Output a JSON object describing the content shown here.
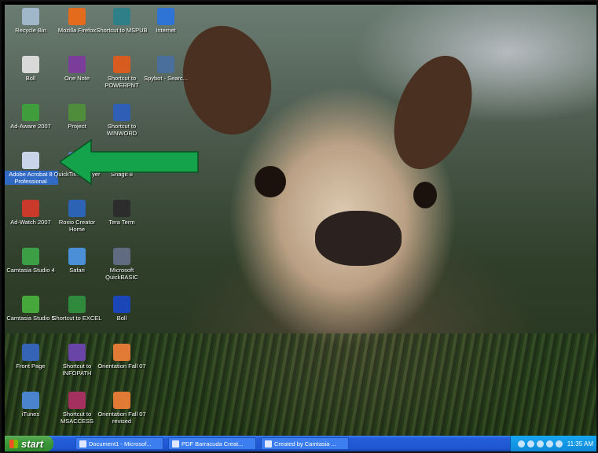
{
  "desktop": {
    "icons": [
      {
        "label": "Recycle Bin",
        "icon": "recycle-bin-icon",
        "color": "#9fb7c9"
      },
      {
        "label": "Mozilla Firefox",
        "icon": "firefox-icon",
        "color": "#e46b1b"
      },
      {
        "label": "Shortcut to MSPUB",
        "icon": "publisher-icon",
        "color": "#2f7f89"
      },
      {
        "label": "Internet",
        "icon": "internet-explorer-icon",
        "color": "#2e74d6"
      },
      {
        "label": "Boll",
        "icon": "document-icon",
        "color": "#d9d9d9"
      },
      {
        "label": "One Note",
        "icon": "onenote-icon",
        "color": "#7a3d9a"
      },
      {
        "label": "Shortcut to POWERPNT",
        "icon": "powerpoint-icon",
        "color": "#d85b20"
      },
      {
        "label": "Spybot - Searc...",
        "icon": "spybot-icon",
        "color": "#4b6f9c"
      },
      {
        "label": "Ad-Aware 2007",
        "icon": "ad-aware-icon",
        "color": "#3f9d3c"
      },
      {
        "label": "Project",
        "icon": "project-icon",
        "color": "#4f8d3d"
      },
      {
        "label": "Shortcut to WINWORD",
        "icon": "word-icon",
        "color": "#2f5fb6"
      },
      {
        "label": "Adobe Acrobat 8 Professional",
        "icon": "adobe-acrobat-icon",
        "color": "#c9d4ea"
      },
      {
        "label": "QuickTime Player",
        "icon": "quicktime-icon",
        "color": "#5a7fc4"
      },
      {
        "label": "SnagIt 8",
        "icon": "snagit-icon",
        "color": "#3d7ec0"
      },
      {
        "label": "Ad-Watch 2007",
        "icon": "ad-watch-icon",
        "color": "#c93a2b"
      },
      {
        "label": "Roxio Creator Home",
        "icon": "roxio-icon",
        "color": "#2d63b5"
      },
      {
        "label": "Tera Term",
        "icon": "teraterm-icon",
        "color": "#2c2c2c"
      },
      {
        "label": "Camtasia Studio 4",
        "icon": "camtasia-icon",
        "color": "#3c9f46"
      },
      {
        "label": "Safari",
        "icon": "safari-icon",
        "color": "#4a8fd8"
      },
      {
        "label": "Microsoft QuickBASIC",
        "icon": "quickbasic-icon",
        "color": "#606a80"
      },
      {
        "label": "Camtasia Studio 5",
        "icon": "camtasia-5-icon",
        "color": "#46a83a"
      },
      {
        "label": "Shortcut to EXCEL",
        "icon": "excel-icon",
        "color": "#2f8a3e"
      },
      {
        "label": "Boll",
        "icon": "s-icon",
        "color": "#1b46b8"
      },
      {
        "label": "Front Page",
        "icon": "frontpage-icon",
        "color": "#3563b5"
      },
      {
        "label": "Shortcut to INFOPATH",
        "icon": "infopath-icon",
        "color": "#6a45a8"
      },
      {
        "label": "Orientation Fall 07",
        "icon": "powerpoint-file-icon",
        "color": "#e07a34"
      },
      {
        "label": "iTunes",
        "icon": "itunes-icon",
        "color": "#4a84cf"
      },
      {
        "label": "Shortcut to MSACCESS",
        "icon": "access-icon",
        "color": "#a3305f"
      },
      {
        "label": "Orientation Fall 07 revised",
        "icon": "powerpoint-file-icon",
        "color": "#e07a34"
      }
    ],
    "arrow_color": "#14a34a"
  },
  "taskbar": {
    "start_label": "start",
    "tasks": [
      {
        "label": "Document1 - Microsof..."
      },
      {
        "label": "PDF Barracuda Creat..."
      },
      {
        "label": "Created by Camtasia ..."
      }
    ],
    "clock": "11:35 AM"
  }
}
